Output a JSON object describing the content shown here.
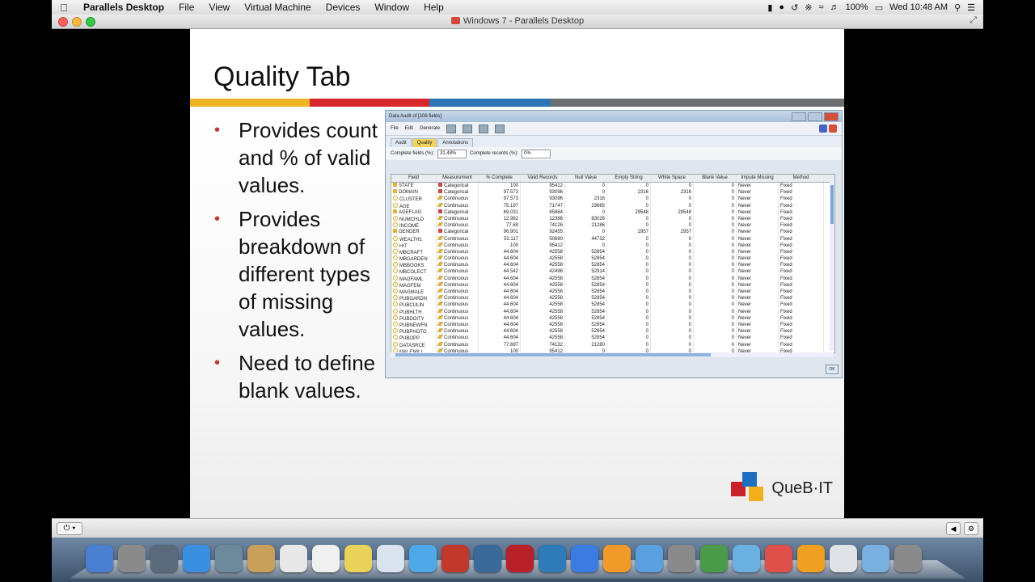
{
  "menubar": {
    "app": "Parallels Desktop",
    "items": [
      "File",
      "View",
      "Virtual Machine",
      "Devices",
      "Window",
      "Help"
    ],
    "battery": "100%",
    "clock": "Wed 10:48 AM"
  },
  "window": {
    "title": "Windows 7 - Parallels Desktop"
  },
  "slide": {
    "title": "Quality Tab",
    "bullets": [
      "Provides count and % of valid values.",
      "Provides breakdown of different types of missing values.",
      "Need to define blank values."
    ],
    "brand": "QueB·IT",
    "stripe_colors": [
      "#f0b323",
      "#d7262c",
      "#2e74b5",
      "#6d6e71"
    ]
  },
  "audit": {
    "title": "Data Audit of [108 fields]",
    "menu": [
      "File",
      "Edit",
      "Generate"
    ],
    "tabs": [
      "Audit",
      "Quality",
      "Annotations"
    ],
    "complete_fields_label": "Complete fields (%):",
    "complete_fields_value": "31.48%",
    "complete_records_label": "Complete records (%):",
    "complete_records_value": "0%",
    "ok_label": "OK",
    "columns": [
      "Field",
      "Measurement",
      "% Complete",
      "Valid Records",
      "Null Value",
      "Empty String",
      "White Space",
      "Blank Value",
      "Impute Missing",
      "Method"
    ],
    "rows": [
      [
        "STATE",
        "Categorical",
        "100",
        "95412",
        "0",
        "0",
        "0",
        "0",
        "Never",
        "Fixed"
      ],
      [
        "DOMAIN",
        "Categorical",
        "97.573",
        "93096",
        "0",
        "2316",
        "2316",
        "0",
        "Never",
        "Fixed"
      ],
      [
        "CLUSTER",
        "Continuous",
        "97.573",
        "93096",
        "2316",
        "0",
        "0",
        "0",
        "Never",
        "Fixed"
      ],
      [
        "AGE",
        "Continuous",
        "75.197",
        "71747",
        "23665",
        "0",
        "0",
        "0",
        "Never",
        "Fixed"
      ],
      [
        "AGEFLAG",
        "Categorical",
        "69.031",
        "65864",
        "0",
        "29548",
        "29548",
        "0",
        "Never",
        "Fixed"
      ],
      [
        "NUMCHLD",
        "Continuous",
        "12.982",
        "12386",
        "83026",
        "0",
        "0",
        "0",
        "Never",
        "Fixed"
      ],
      [
        "INCOME",
        "Continuous",
        "77.69",
        "74126",
        "21286",
        "0",
        "0",
        "0",
        "Never",
        "Fixed"
      ],
      [
        "GENDER",
        "Categorical",
        "96.901",
        "92455",
        "0",
        "2957",
        "2957",
        "0",
        "Never",
        "Fixed"
      ],
      [
        "WEALTH1",
        "Continuous",
        "53.117",
        "50680",
        "44732",
        "0",
        "0",
        "0",
        "Never",
        "Fixed"
      ],
      [
        "HIT",
        "Continuous",
        "100",
        "95412",
        "0",
        "0",
        "0",
        "0",
        "Never",
        "Fixed"
      ],
      [
        "MBCRAFT",
        "Continuous",
        "44.604",
        "42558",
        "52854",
        "0",
        "0",
        "0",
        "Never",
        "Fixed"
      ],
      [
        "MBGARDEN",
        "Continuous",
        "44.604",
        "42558",
        "52854",
        "0",
        "0",
        "0",
        "Never",
        "Fixed"
      ],
      [
        "MBBOOKS",
        "Continuous",
        "44.604",
        "42558",
        "52854",
        "0",
        "0",
        "0",
        "Never",
        "Fixed"
      ],
      [
        "MBCOLECT",
        "Continuous",
        "44.542",
        "42498",
        "52914",
        "0",
        "0",
        "0",
        "Never",
        "Fixed"
      ],
      [
        "MAGFAML",
        "Continuous",
        "44.604",
        "42558",
        "52854",
        "0",
        "0",
        "0",
        "Never",
        "Fixed"
      ],
      [
        "MAGFEM",
        "Continuous",
        "44.604",
        "42558",
        "52854",
        "0",
        "0",
        "0",
        "Never",
        "Fixed"
      ],
      [
        "MAGMALE",
        "Continuous",
        "44.604",
        "42558",
        "52854",
        "0",
        "0",
        "0",
        "Never",
        "Fixed"
      ],
      [
        "PUBGARDN",
        "Continuous",
        "44.604",
        "42558",
        "52854",
        "0",
        "0",
        "0",
        "Never",
        "Fixed"
      ],
      [
        "PUBCULIN",
        "Continuous",
        "44.604",
        "42558",
        "52854",
        "0",
        "0",
        "0",
        "Never",
        "Fixed"
      ],
      [
        "PUBHLTH",
        "Continuous",
        "44.604",
        "42558",
        "52854",
        "0",
        "0",
        "0",
        "Never",
        "Fixed"
      ],
      [
        "PUBDOITY",
        "Continuous",
        "44.604",
        "42558",
        "52854",
        "0",
        "0",
        "0",
        "Never",
        "Fixed"
      ],
      [
        "PUBNEWFN",
        "Continuous",
        "44.604",
        "42558",
        "52854",
        "0",
        "0",
        "0",
        "Never",
        "Fixed"
      ],
      [
        "PUBPHOTO",
        "Continuous",
        "44.604",
        "42558",
        "52854",
        "0",
        "0",
        "0",
        "Never",
        "Fixed"
      ],
      [
        "PUBOPP",
        "Continuous",
        "44.604",
        "42558",
        "52854",
        "0",
        "0",
        "0",
        "Never",
        "Fixed"
      ],
      [
        "DATASRCE",
        "Continuous",
        "77.697",
        "74132",
        "21280",
        "0",
        "0",
        "0",
        "Never",
        "Fixed"
      ],
      [
        "MALEMILI",
        "Continuous",
        "100",
        "95412",
        "0",
        "0",
        "0",
        "0",
        "Never",
        "Fixed"
      ]
    ]
  },
  "dock": {
    "colors": [
      "#4a7fd0",
      "#8a8a8a",
      "#5a6a7a",
      "#3b8fe0",
      "#6d8a9c",
      "#c9a05a",
      "#e8e8e8",
      "#f0f0f0",
      "#e8d25a",
      "#d9e4ef",
      "#4fa8e8",
      "#c0392b",
      "#3a6a9a",
      "#b8202a",
      "#2f7ab8",
      "#3b7ce0",
      "#f09a2a",
      "#5aa0e0",
      "#8a8a8a",
      "#4a9a4a",
      "#6ab0e0",
      "#e0504a",
      "#f0a020",
      "#dfe3e8",
      "#7ab0e0",
      "#8a8a8a"
    ]
  }
}
